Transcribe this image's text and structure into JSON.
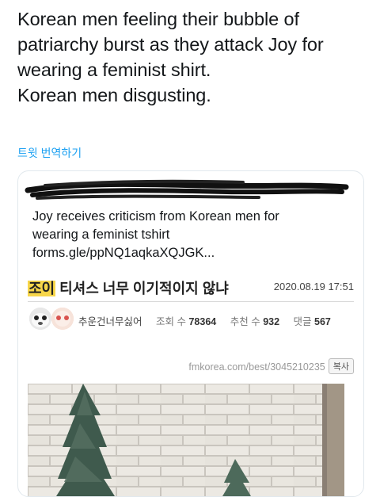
{
  "tweet": {
    "lines": [
      "Korean men feeling their bubble of",
      "patriarchy burst as they attack Joy for",
      "wearing a feminist shirt.",
      "Korean men disgusting."
    ],
    "translate_label": "트윗 번역하기"
  },
  "quoted_tweet": {
    "lines": [
      "Joy receives criticism from Korean men for",
      "wearing a feminist tshirt",
      "forms.gle/ppNQ1aqkaXQJGK..."
    ]
  },
  "screenshot": {
    "title_highlight": "조이",
    "title_rest": " 티셔스 너무 이기적이지 않냐",
    "date": "2020.08.19 17:51",
    "nickname": "추운건너무싫어",
    "views_label": "조회 수",
    "views": "78364",
    "recommend_label": "추천 수",
    "recommend": "932",
    "comments_label": "댓글",
    "comments": "567",
    "url": "fmkorea.com/best/3045210235",
    "copy_label": "복사"
  },
  "colors": {
    "link": "#1da1f2",
    "highlight": "#f7d64a",
    "card_border": "#e1e8ed"
  }
}
